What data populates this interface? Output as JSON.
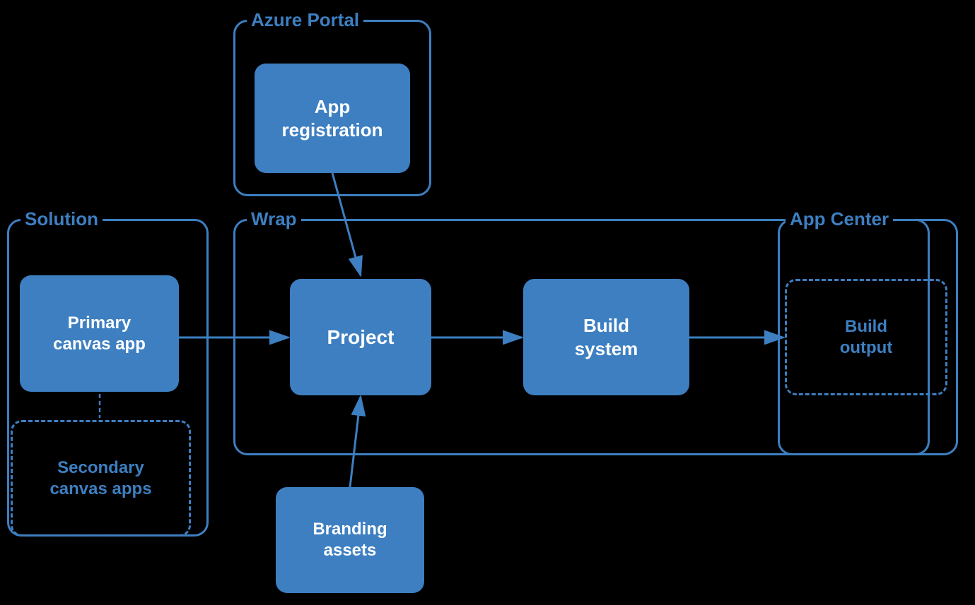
{
  "diagram": {
    "background": "#000000",
    "accent_color": "#3d7fc1",
    "containers": {
      "azure_portal": {
        "label": "Azure Portal",
        "inner_box_label": "App\nregistration"
      },
      "solution": {
        "label": "Solution"
      },
      "wrap": {
        "label": "Wrap"
      },
      "app_center": {
        "label": "App Center"
      }
    },
    "boxes": {
      "app_registration": "App\nregistration",
      "primary_canvas_app": "Primary\ncanvas app",
      "secondary_canvas_apps": "Secondary\ncanvas apps",
      "project": "Project",
      "build_system": "Build\nsystem",
      "build_output": "Build\noutput",
      "branding_assets": "Branding\nassets"
    }
  }
}
